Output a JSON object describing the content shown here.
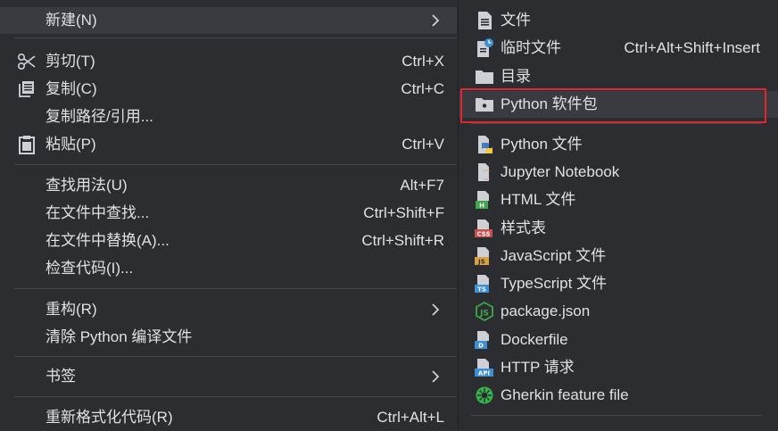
{
  "left_menu": {
    "new": {
      "label": "新建(N)"
    },
    "cut": {
      "label": "剪切(T)",
      "shortcut": "Ctrl+X",
      "icon": "scissors-icon"
    },
    "copy": {
      "label": "复制(C)",
      "shortcut": "Ctrl+C",
      "icon": "copy-icon"
    },
    "copy_path": {
      "label": "复制路径/引用..."
    },
    "paste": {
      "label": "粘贴(P)",
      "shortcut": "Ctrl+V",
      "icon": "clipboard-icon"
    },
    "find_usages": {
      "label": "查找用法(U)",
      "shortcut": "Alt+F7"
    },
    "find_in_files": {
      "label": "在文件中查找...",
      "shortcut": "Ctrl+Shift+F"
    },
    "replace_in_files": {
      "label": "在文件中替换(A)...",
      "shortcut": "Ctrl+Shift+R"
    },
    "inspect_code": {
      "label": "检查代码(I)..."
    },
    "refactor": {
      "label": "重构(R)"
    },
    "clean_python": {
      "label": "清除 Python 编译文件"
    },
    "bookmarks": {
      "label": "书签"
    },
    "reformat": {
      "label": "重新格式化代码(R)",
      "shortcut": "Ctrl+Alt+L"
    }
  },
  "right_menu": {
    "file": {
      "label": "文件",
      "icon": "file-icon"
    },
    "scratch": {
      "label": "临时文件",
      "shortcut": "Ctrl+Alt+Shift+Insert",
      "icon": "scratch-file-icon"
    },
    "directory": {
      "label": "目录",
      "icon": "folder-icon"
    },
    "python_package": {
      "label": "Python 软件包",
      "icon": "python-package-icon"
    },
    "python_file": {
      "label": "Python 文件",
      "icon": "python-file-icon"
    },
    "jupyter": {
      "label": "Jupyter Notebook",
      "icon": "jupyter-icon"
    },
    "html": {
      "label": "HTML 文件",
      "icon": "html-file-icon",
      "badge": "H"
    },
    "css": {
      "label": "样式表",
      "icon": "css-file-icon",
      "badge": "CSS"
    },
    "js": {
      "label": "JavaScript 文件",
      "icon": "js-file-icon",
      "badge": "JS"
    },
    "ts": {
      "label": "TypeScript 文件",
      "icon": "ts-file-icon",
      "badge": "TS"
    },
    "package_json": {
      "label": "package.json",
      "icon": "nodejs-icon"
    },
    "dockerfile": {
      "label": "Dockerfile",
      "icon": "dockerfile-icon",
      "badge": "D"
    },
    "http": {
      "label": "HTTP 请求",
      "icon": "http-file-icon",
      "badge": "API"
    },
    "gherkin": {
      "label": "Gherkin feature file",
      "icon": "gherkin-icon"
    }
  },
  "colors": {
    "menu_bg": "#2b2d30",
    "highlight_bg": "#393b40",
    "text": "#dfe1e5",
    "icon_gray": "#ced0d6",
    "focus_box": "#e0262f",
    "html_badge": "#3fa64c",
    "css_badge": "#c94f4f",
    "js_badge": "#d9a343",
    "ts_badge": "#3d8fd6",
    "python_blue": "#3f7cc4",
    "python_yellow": "#f2c744",
    "jupyter_orange": "#e0762f",
    "node_green": "#3fa64c",
    "gherkin_green": "#34b44a"
  }
}
